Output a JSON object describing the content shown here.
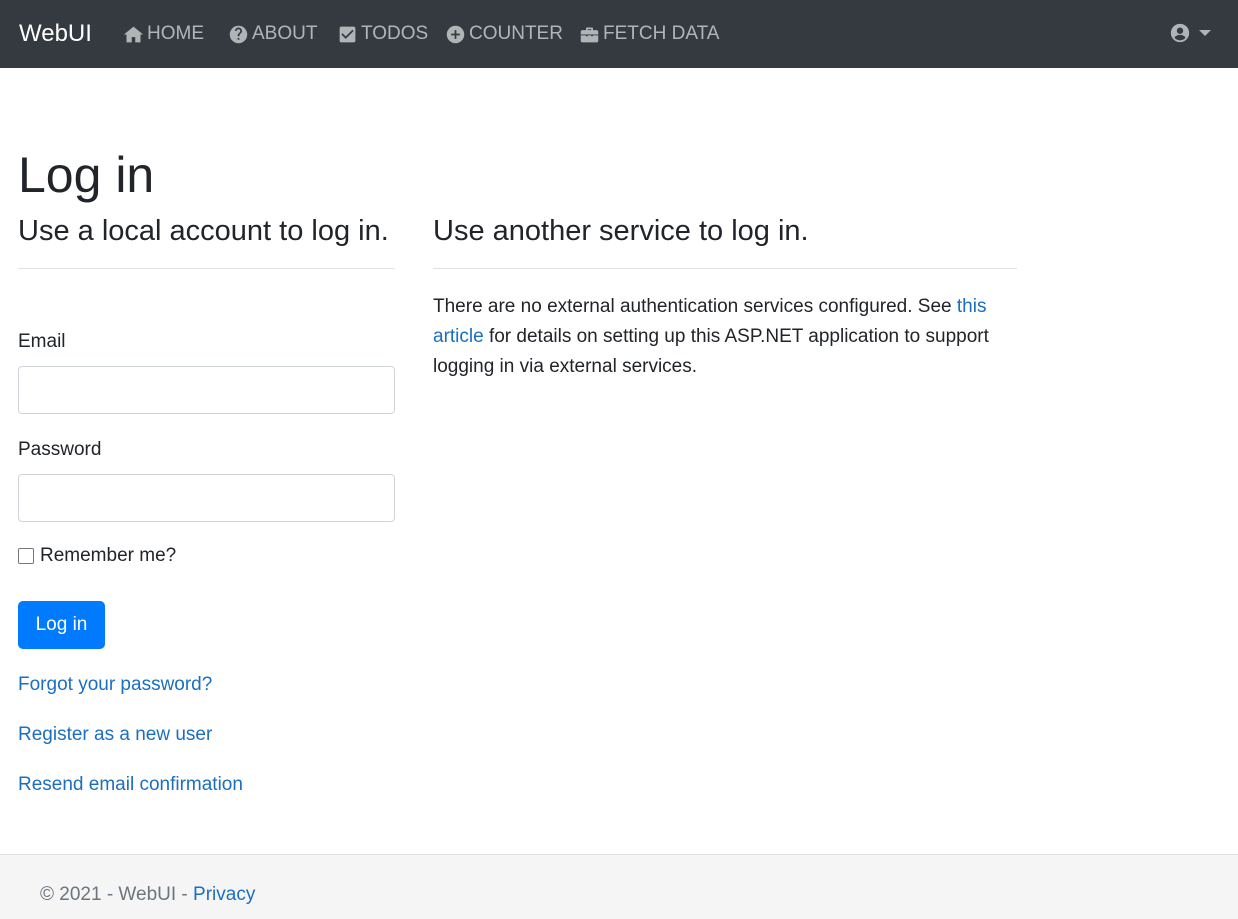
{
  "nav": {
    "brand": "WebUI",
    "items": [
      {
        "label": "HOME",
        "icon": "home-icon"
      },
      {
        "label": "ABOUT",
        "icon": "question-circle-icon"
      },
      {
        "label": "TODOS",
        "icon": "check-square-icon"
      },
      {
        "label": "COUNTER",
        "icon": "plus-circle-icon"
      },
      {
        "label": "FETCH DATA",
        "icon": "toolbox-icon"
      }
    ],
    "user_icon": "user-circle-icon"
  },
  "page": {
    "title": "Log in"
  },
  "local_login": {
    "heading": "Use a local account to log in.",
    "email_label": "Email",
    "email_value": "",
    "password_label": "Password",
    "password_value": "",
    "remember_label": "Remember me?",
    "remember_checked": false,
    "submit_label": "Log in",
    "forgot_link": "Forgot your password?",
    "register_link": "Register as a new user",
    "resend_link": "Resend email confirmation"
  },
  "external_login": {
    "heading": "Use another service to log in.",
    "text_before": "There are no external authentication services configured. See ",
    "link_text": "this article",
    "text_after": " for details on setting up this ASP.NET application to support logging in via external services."
  },
  "footer": {
    "copyright": "© 2021 - WebUI - ",
    "privacy_link": "Privacy"
  },
  "colors": {
    "navbar_bg": "#343a40",
    "primary": "#007bff",
    "link": "#1b6ec2",
    "footer_bg": "#f5f5f5"
  }
}
